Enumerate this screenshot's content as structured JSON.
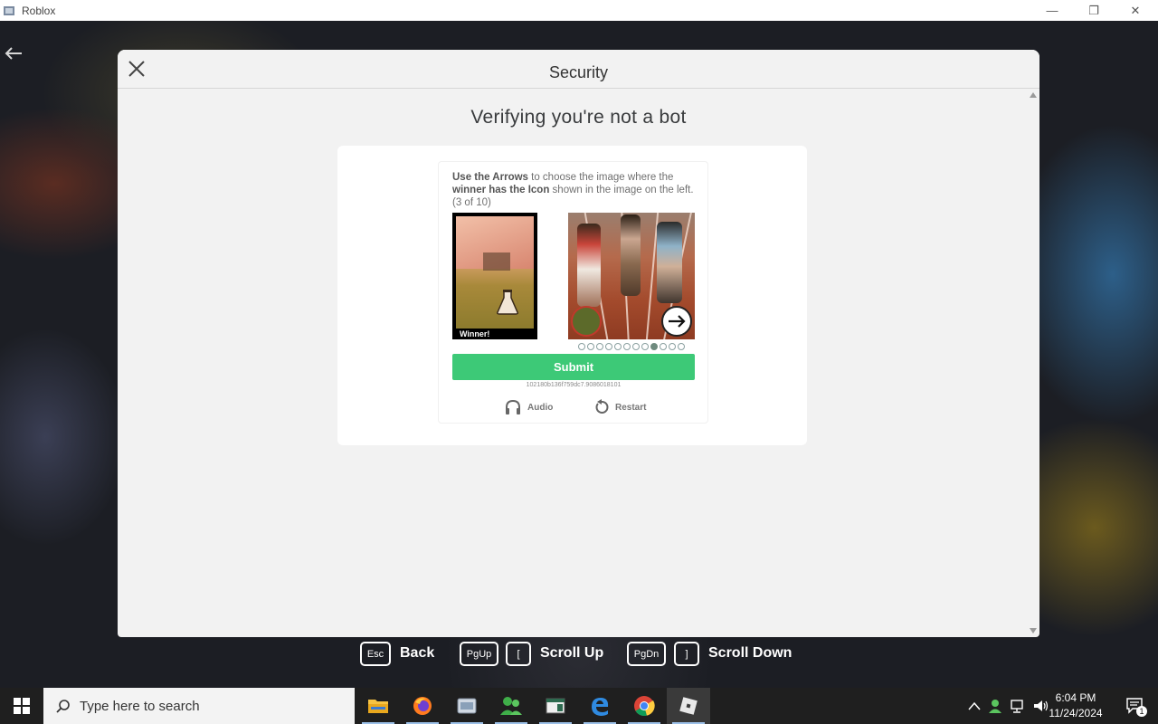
{
  "window": {
    "title": "Roblox",
    "minimize_glyph": "—",
    "maximize_glyph": "❐",
    "close_glyph": "✕"
  },
  "modal": {
    "title": "Security",
    "heading": "Verifying you're not a bot"
  },
  "captcha": {
    "instr_bold_1": "Use the Arrows",
    "instr_text_1": " to choose the image where the ",
    "instr_bold_2": "winner has the Icon",
    "instr_text_2": " shown in the image on the left. (3 of 10)",
    "winner_label": "Winner!",
    "submit_label": "Submit",
    "session_id": "102180b136f759dc7.9086018101",
    "audio_label": "Audio",
    "restart_label": "Restart",
    "page_total": 12,
    "page_current": 9,
    "accent_color": "#3dc977"
  },
  "hints": {
    "esc_key": "Esc",
    "back_label": "Back",
    "pgup_key": "PgUp",
    "bracket_open_key": "[",
    "scroll_up_label": "Scroll Up",
    "pgdn_key": "PgDn",
    "bracket_close_key": "]",
    "scroll_down_label": "Scroll Down"
  },
  "taskbar": {
    "search_placeholder": "Type here to search",
    "time": "6:04 PM",
    "date": "11/24/2024",
    "notification_count": "1",
    "apps": [
      "file-explorer",
      "firefox",
      "app-3",
      "people",
      "app-5",
      "edge",
      "chrome",
      "roblox"
    ]
  }
}
